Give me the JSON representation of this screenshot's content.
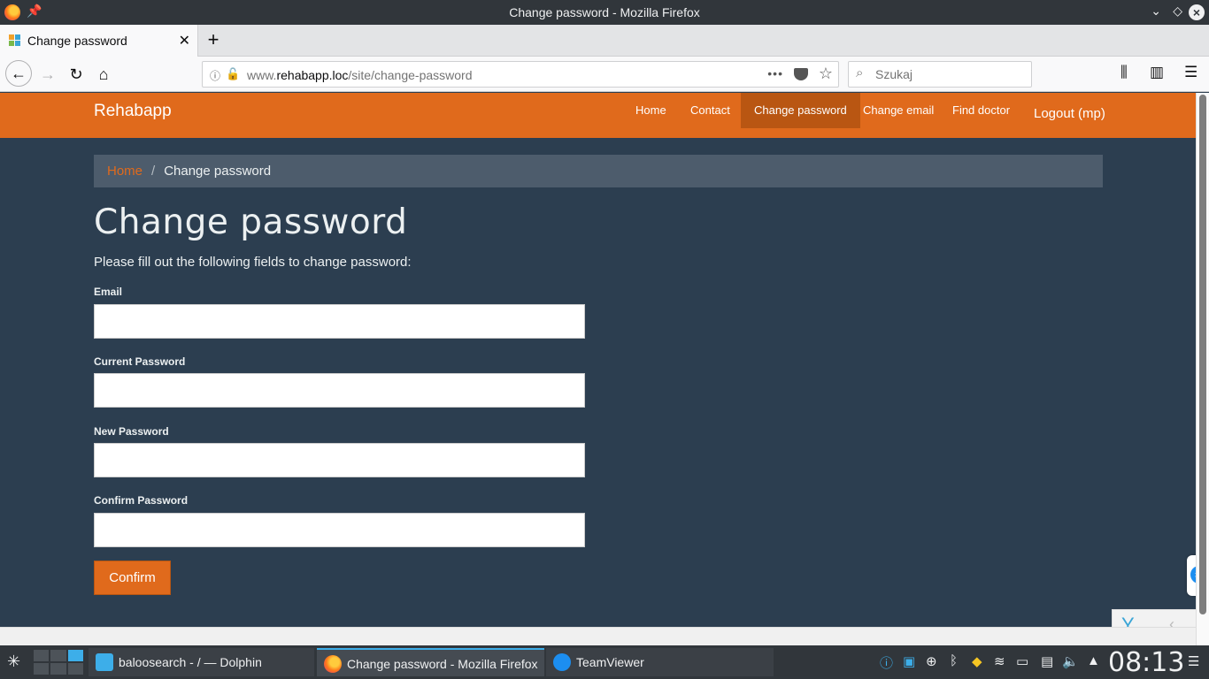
{
  "window": {
    "title": "Change password - Mozilla Firefox"
  },
  "tab": {
    "title": "Change password",
    "close": "✕"
  },
  "newtab": "+",
  "nav": {
    "url_prefix": "www.",
    "url_domain": "rehabapp.loc",
    "url_path": "/site/change-password",
    "more": "•••",
    "search_placeholder": "Szukaj"
  },
  "site": {
    "brand": "Rehabapp",
    "menu": [
      {
        "label": "Home"
      },
      {
        "label": "Contact"
      },
      {
        "label": "Change password",
        "active": true
      },
      {
        "label": "Change email"
      },
      {
        "label": "Find doctor"
      }
    ],
    "logout": "Logout (mp)"
  },
  "breadcrumb": {
    "home": "Home",
    "sep": "/",
    "current": "Change password"
  },
  "page": {
    "title": "Change password",
    "intro": "Please fill out the following fields to change password:"
  },
  "form": {
    "email_label": "Email",
    "email_value": "",
    "current_password_label": "Current Password",
    "current_password_value": "",
    "new_password_label": "New Password",
    "new_password_value": "",
    "confirm_password_label": "Confirm Password",
    "confirm_password_value": "",
    "submit_label": "Confirm"
  },
  "taskbar": {
    "tasks": [
      {
        "label": "baloosearch - / — Dolphin"
      },
      {
        "label": "Change password - Mozilla Firefox",
        "active": true
      },
      {
        "label": "TeamViewer"
      }
    ],
    "clock": "08:13"
  },
  "colors": {
    "accent": "#e06a1c",
    "page_bg": "#2c3e50",
    "breadcrumb_bg": "#4d5c6c",
    "nav_active": "#b95612",
    "kde_panel": "#31363b",
    "kde_highlight": "#3daee9"
  },
  "icons": [
    "firefox-icon",
    "pin-icon",
    "back-icon",
    "forward-icon",
    "reload-icon",
    "home-icon",
    "info-icon",
    "insecure-lock-icon",
    "pocket-icon",
    "bookmark-star-icon",
    "search-icon",
    "library-icon",
    "sidebar-icon",
    "menu-icon",
    "yii-logo-icon",
    "teamviewer-icon"
  ]
}
